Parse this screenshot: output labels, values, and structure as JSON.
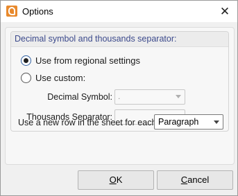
{
  "window": {
    "title": "Options"
  },
  "icons": {
    "app": "foxit-app-icon",
    "close": "close-icon"
  },
  "group": {
    "title": "Decimal symbol and thousands separator:"
  },
  "radios": [
    {
      "label": "Use from regional settings",
      "checked": true
    },
    {
      "label": "Use custom:",
      "checked": false
    }
  ],
  "custom": {
    "decimal_label": "Decimal Symbol:",
    "decimal_value": ".",
    "thousands_label": "Thousands Separator:",
    "thousands_value": ""
  },
  "new_row": {
    "label": "Use a new row in the sheet for each:",
    "value": "Paragraph"
  },
  "buttons": {
    "ok": {
      "mnemonic": "O",
      "rest": "K"
    },
    "cancel": {
      "mnemonic": "C",
      "rest": "ancel"
    }
  }
}
